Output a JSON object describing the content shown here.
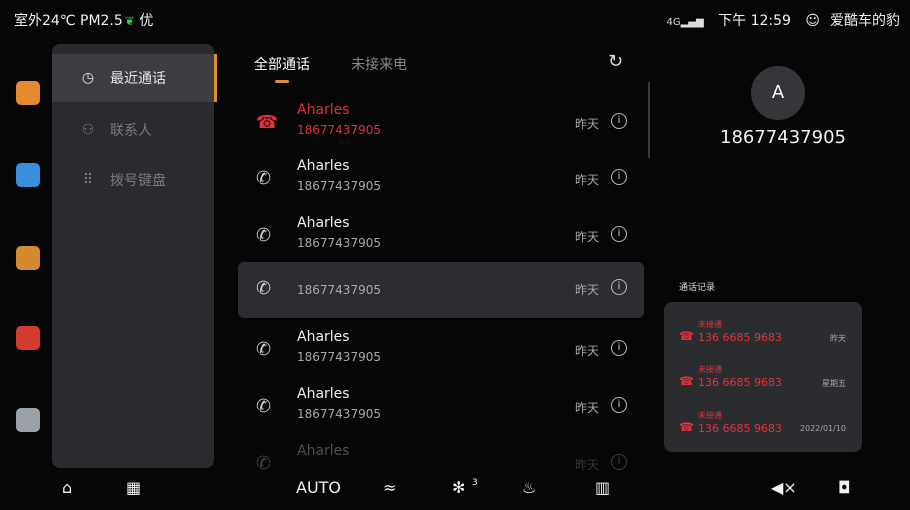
{
  "status": {
    "outdoor": "室外24℃",
    "pm": "PM2.5",
    "air": "优",
    "signal": "4G",
    "time": "下午 12:59",
    "user": "爱酷车的豹"
  },
  "dock": [
    {
      "name": "car-app",
      "icon": "car-icon",
      "color": "#e58a2e"
    },
    {
      "name": "maps-app",
      "icon": "map-icon",
      "color": "#3a8fdc"
    },
    {
      "name": "media-app",
      "icon": "media-icon",
      "color": "#d38b2e"
    },
    {
      "name": "radio-app",
      "icon": "radio-icon",
      "color": "#d33b2e"
    },
    {
      "name": "settings-app",
      "icon": "gear-icon",
      "color": "#9aa0a6"
    }
  ],
  "sidebar": {
    "items": [
      {
        "label": "最近通话",
        "icon": "clock-icon",
        "active": true
      },
      {
        "label": "联系人",
        "icon": "person-icon",
        "active": false
      },
      {
        "label": "拨号键盘",
        "icon": "dialpad-icon",
        "active": false
      }
    ]
  },
  "tabs": [
    {
      "label": "全部通话",
      "active": true
    },
    {
      "label": "未接来电",
      "active": false
    }
  ],
  "calls": [
    {
      "name": "Aharles",
      "number": "18677437905",
      "date": "昨天",
      "type": "missed"
    },
    {
      "name": "Aharles",
      "number": "18677437905",
      "date": "昨天",
      "type": "incoming"
    },
    {
      "name": "Aharles",
      "number": "18677437905",
      "date": "昨天",
      "type": "incoming"
    },
    {
      "name": "",
      "number": "18677437905",
      "date": "昨天",
      "type": "incoming",
      "selected": true
    },
    {
      "name": "Aharles",
      "number": "18677437905",
      "date": "昨天",
      "type": "incoming"
    },
    {
      "name": "Aharles",
      "number": "18677437905",
      "date": "昨天",
      "type": "incoming"
    },
    {
      "name": "Aharles",
      "number": "",
      "date": "昨天",
      "type": "incoming",
      "faded": true
    }
  ],
  "detail": {
    "avatar": "A",
    "number": "18677437905",
    "history_title": "通话记录",
    "history": [
      {
        "status": "未接通",
        "number": "136 6685 9683",
        "date": "昨天"
      },
      {
        "status": "未接通",
        "number": "136 6685 9683",
        "date": "星期五"
      },
      {
        "status": "未接通",
        "number": "136 6685 9683",
        "date": "2022/01/10"
      }
    ]
  },
  "bottom": {
    "auto": "AUTO",
    "fan_level": "3"
  }
}
